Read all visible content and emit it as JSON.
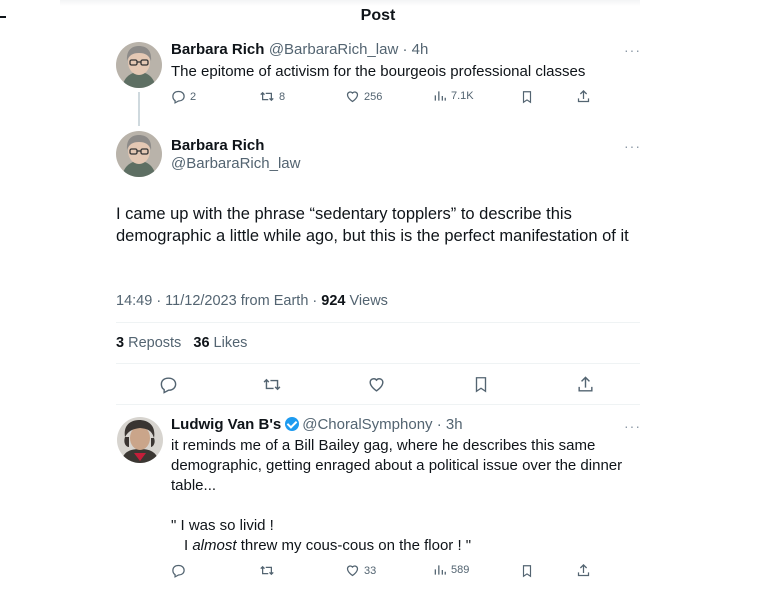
{
  "header": {
    "title": "Post"
  },
  "parent_tweet": {
    "name": "Barbara Rich",
    "handle": "@BarbaraRich_law",
    "time": "4h",
    "text": "The epitome of activism for the bourgeois professional classes",
    "replies": "2",
    "reposts": "8",
    "likes": "256",
    "views": "7.1K",
    "more": "···"
  },
  "main_tweet": {
    "name": "Barbara Rich",
    "handle": "@BarbaraRich_law",
    "more": "···",
    "text": "I came up with the phrase “sedentary topplers” to describe this demographic a little while ago, but this is the perfect manifestation of it",
    "timestamp": "14:49 · 11/12/2023 from Earth · ",
    "views_count": "924",
    "views_label": " Views",
    "reposts_count": "3",
    "reposts_label": " Reposts",
    "likes_count": "36",
    "likes_label": " Likes"
  },
  "reply_tweet": {
    "name": "Ludwig Van B's",
    "handle": "@ChoralSymphony",
    "time": "3h",
    "more": "···",
    "text1": "it reminds me of a Bill Bailey gag, where he describes this same demographic, getting enraged about a political issue over the dinner table...",
    "quote_line1": "\" I was so livid !",
    "quote_line2_pre": "I ",
    "quote_line2_em": "almost",
    "quote_line2_post": " threw my cous-cous on the floor ! \"",
    "likes": "33",
    "views": "589"
  },
  "colors": {
    "verified": "#1d9bf0",
    "muted": "#536471",
    "divider": "#eff3f4"
  }
}
